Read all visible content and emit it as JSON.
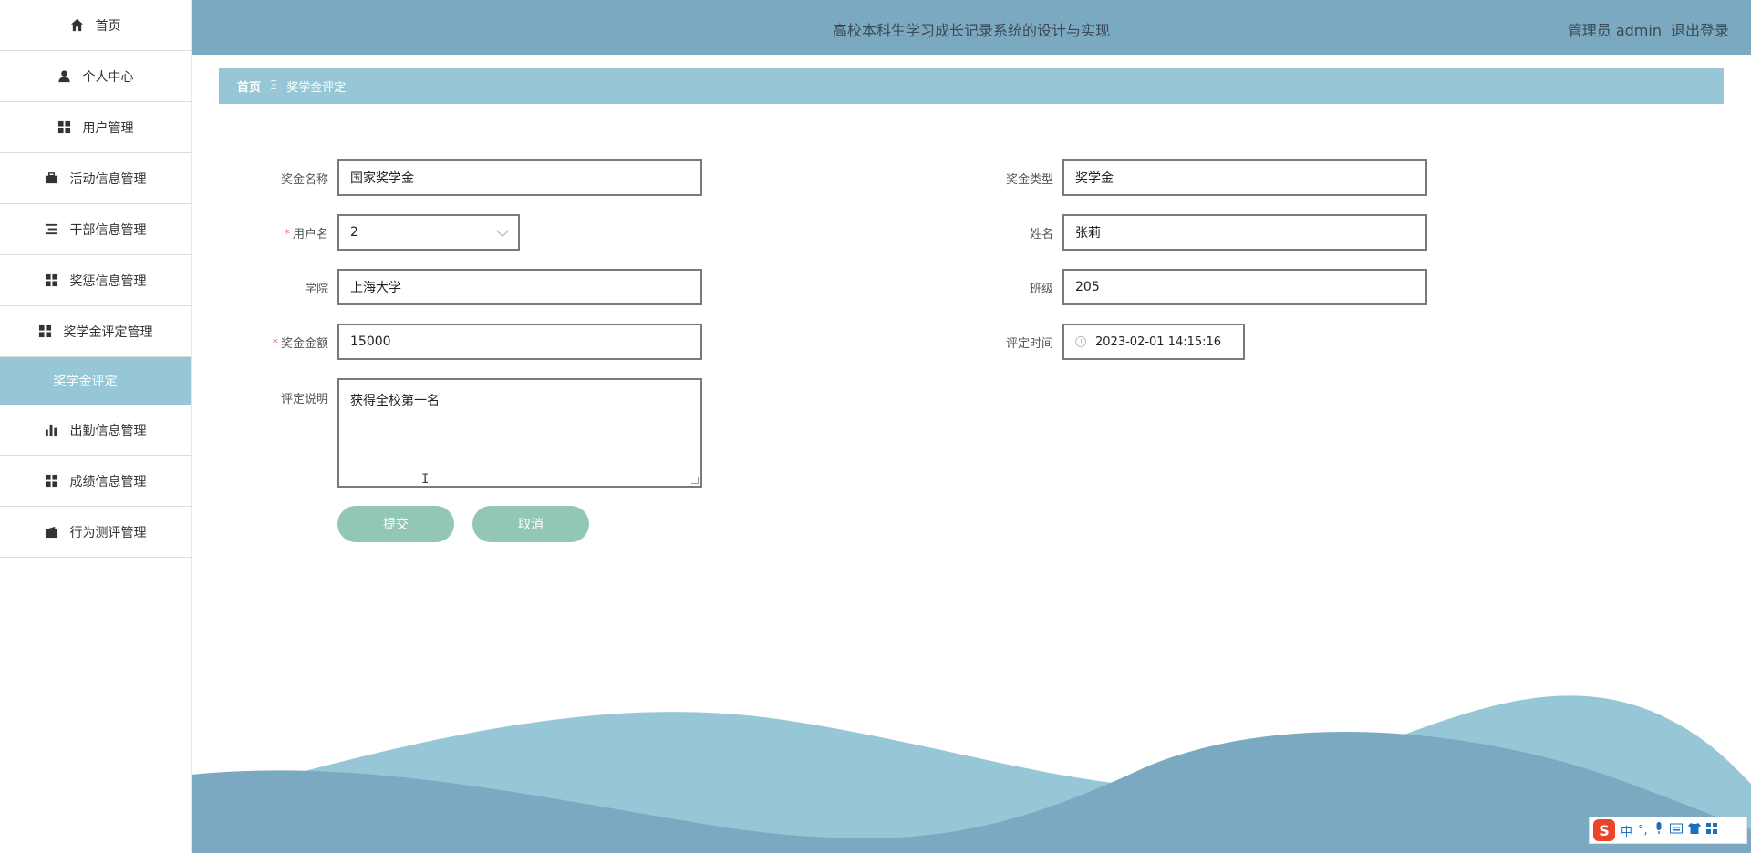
{
  "header": {
    "title": "高校本科生学习成长记录系统的设计与实现",
    "user": "管理员 admin",
    "logout": "退出登录"
  },
  "sidebar": {
    "items": [
      {
        "label": "首页",
        "icon": "home-icon"
      },
      {
        "label": "个人中心",
        "icon": "user-icon"
      },
      {
        "label": "用户管理",
        "icon": "grid-icon"
      },
      {
        "label": "活动信息管理",
        "icon": "briefcase-icon"
      },
      {
        "label": "干部信息管理",
        "icon": "list-icon"
      },
      {
        "label": "奖惩信息管理",
        "icon": "grid-icon"
      },
      {
        "label": "奖学金评定管理",
        "icon": "grid-icon"
      },
      {
        "label": "出勤信息管理",
        "icon": "bar-chart-icon"
      },
      {
        "label": "成绩信息管理",
        "icon": "grid-icon"
      },
      {
        "label": "行为测评管理",
        "icon": "wallet-icon"
      }
    ],
    "active_sub": "奖学金评定"
  },
  "breadcrumb": {
    "home": "首页",
    "sep": "Ξ",
    "current": "奖学金评定"
  },
  "form": {
    "scholarship_name": {
      "label": "奖金名称",
      "value": "国家奖学金"
    },
    "scholarship_type": {
      "label": "奖金类型",
      "value": "奖学金"
    },
    "username": {
      "label": "用户名",
      "value": "2",
      "required": "*"
    },
    "name": {
      "label": "姓名",
      "value": "张莉"
    },
    "college": {
      "label": "学院",
      "value": "上海大学"
    },
    "class": {
      "label": "班级",
      "value": "205"
    },
    "amount": {
      "label": "奖金金额",
      "value": "15000",
      "required": "*"
    },
    "eval_time": {
      "label": "评定时间",
      "value": "2023-02-01 14:15:16"
    },
    "description": {
      "label": "评定说明",
      "value": "获得全校第一名"
    },
    "submit": "提交",
    "cancel": "取消"
  },
  "ime": {
    "logo": "S",
    "mode": "中",
    "punct": "°,"
  },
  "colors": {
    "header": "#7aa9c1",
    "breadcrumb": "#97c7d6",
    "button": "#93c7b5",
    "wave_light": "#97c7d6",
    "wave_dark": "#7aa9c1"
  }
}
